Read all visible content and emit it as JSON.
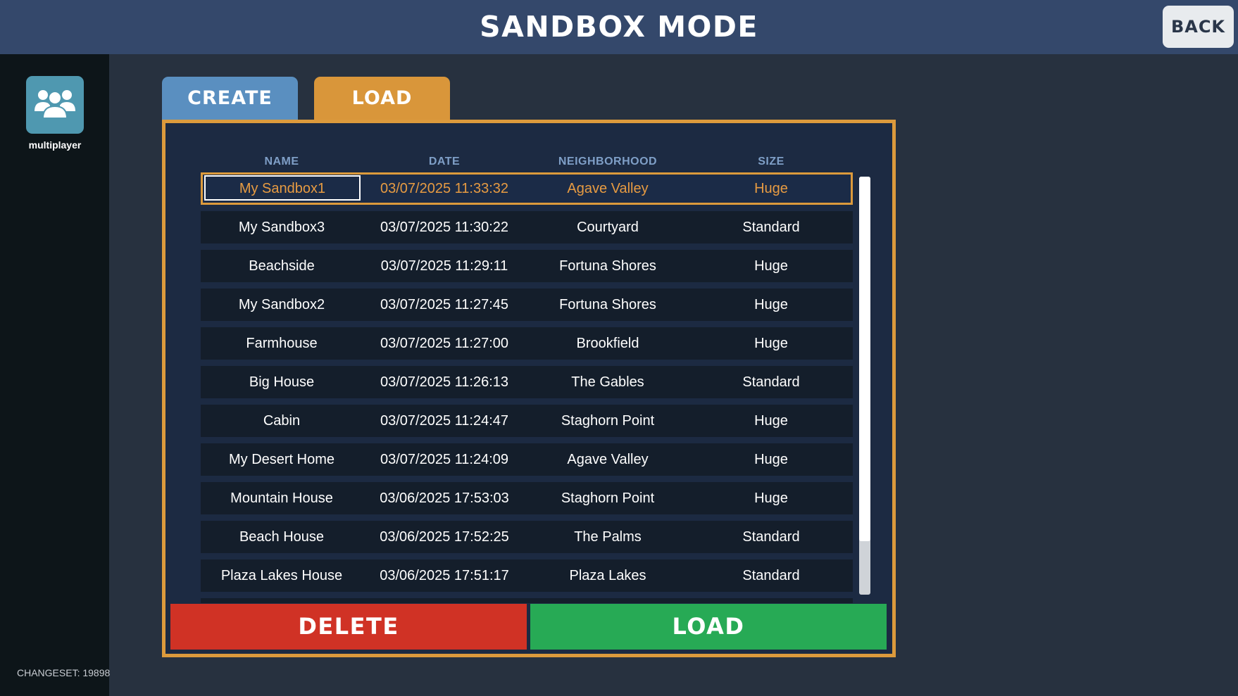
{
  "header": {
    "title": "SANDBOX MODE",
    "back_label": "BACK"
  },
  "sidebar": {
    "multiplayer_label": "multiplayer",
    "changeset": "CHANGESET: 19898"
  },
  "tabs": [
    {
      "label": "CREATE",
      "active": false
    },
    {
      "label": "LOAD",
      "active": true
    }
  ],
  "columns": {
    "name": "NAME",
    "date": "DATE",
    "neighborhood": "NEIGHBORHOOD",
    "size": "SIZE"
  },
  "saves": [
    {
      "name": "My Sandbox1",
      "date": "03/07/2025  11:33:32",
      "neighborhood": "Agave Valley",
      "size": "Huge",
      "selected": true
    },
    {
      "name": "My Sandbox3",
      "date": "03/07/2025  11:30:22",
      "neighborhood": "Courtyard",
      "size": "Standard"
    },
    {
      "name": "Beachside",
      "date": "03/07/2025  11:29:11",
      "neighborhood": "Fortuna Shores",
      "size": "Huge"
    },
    {
      "name": "My Sandbox2",
      "date": "03/07/2025  11:27:45",
      "neighborhood": "Fortuna Shores",
      "size": "Huge"
    },
    {
      "name": "Farmhouse",
      "date": "03/07/2025  11:27:00",
      "neighborhood": "Brookfield",
      "size": "Huge"
    },
    {
      "name": "Big House",
      "date": "03/07/2025  11:26:13",
      "neighborhood": "The Gables",
      "size": "Standard"
    },
    {
      "name": "Cabin",
      "date": "03/07/2025  11:24:47",
      "neighborhood": "Staghorn Point",
      "size": "Huge"
    },
    {
      "name": "My Desert Home",
      "date": "03/07/2025  11:24:09",
      "neighborhood": "Agave Valley",
      "size": "Huge"
    },
    {
      "name": "Mountain House",
      "date": "03/06/2025  17:53:03",
      "neighborhood": "Staghorn Point",
      "size": "Huge"
    },
    {
      "name": "Beach House",
      "date": "03/06/2025  17:52:25",
      "neighborhood": "The Palms",
      "size": "Standard"
    },
    {
      "name": "Plaza Lakes House",
      "date": "03/06/2025  17:51:17",
      "neighborhood": "Plaza Lakes",
      "size": "Standard"
    }
  ],
  "actions": {
    "delete_label": "DELETE",
    "load_label": "LOAD"
  },
  "colors": {
    "header_bg": "#34486b",
    "accent_orange": "#dc9a3c",
    "tab_create": "#5a8fc0",
    "delete": "#d03225",
    "load": "#27aa55",
    "icon_tile": "#4f98b0"
  },
  "icons": {
    "multiplayer": "people-group-icon"
  }
}
